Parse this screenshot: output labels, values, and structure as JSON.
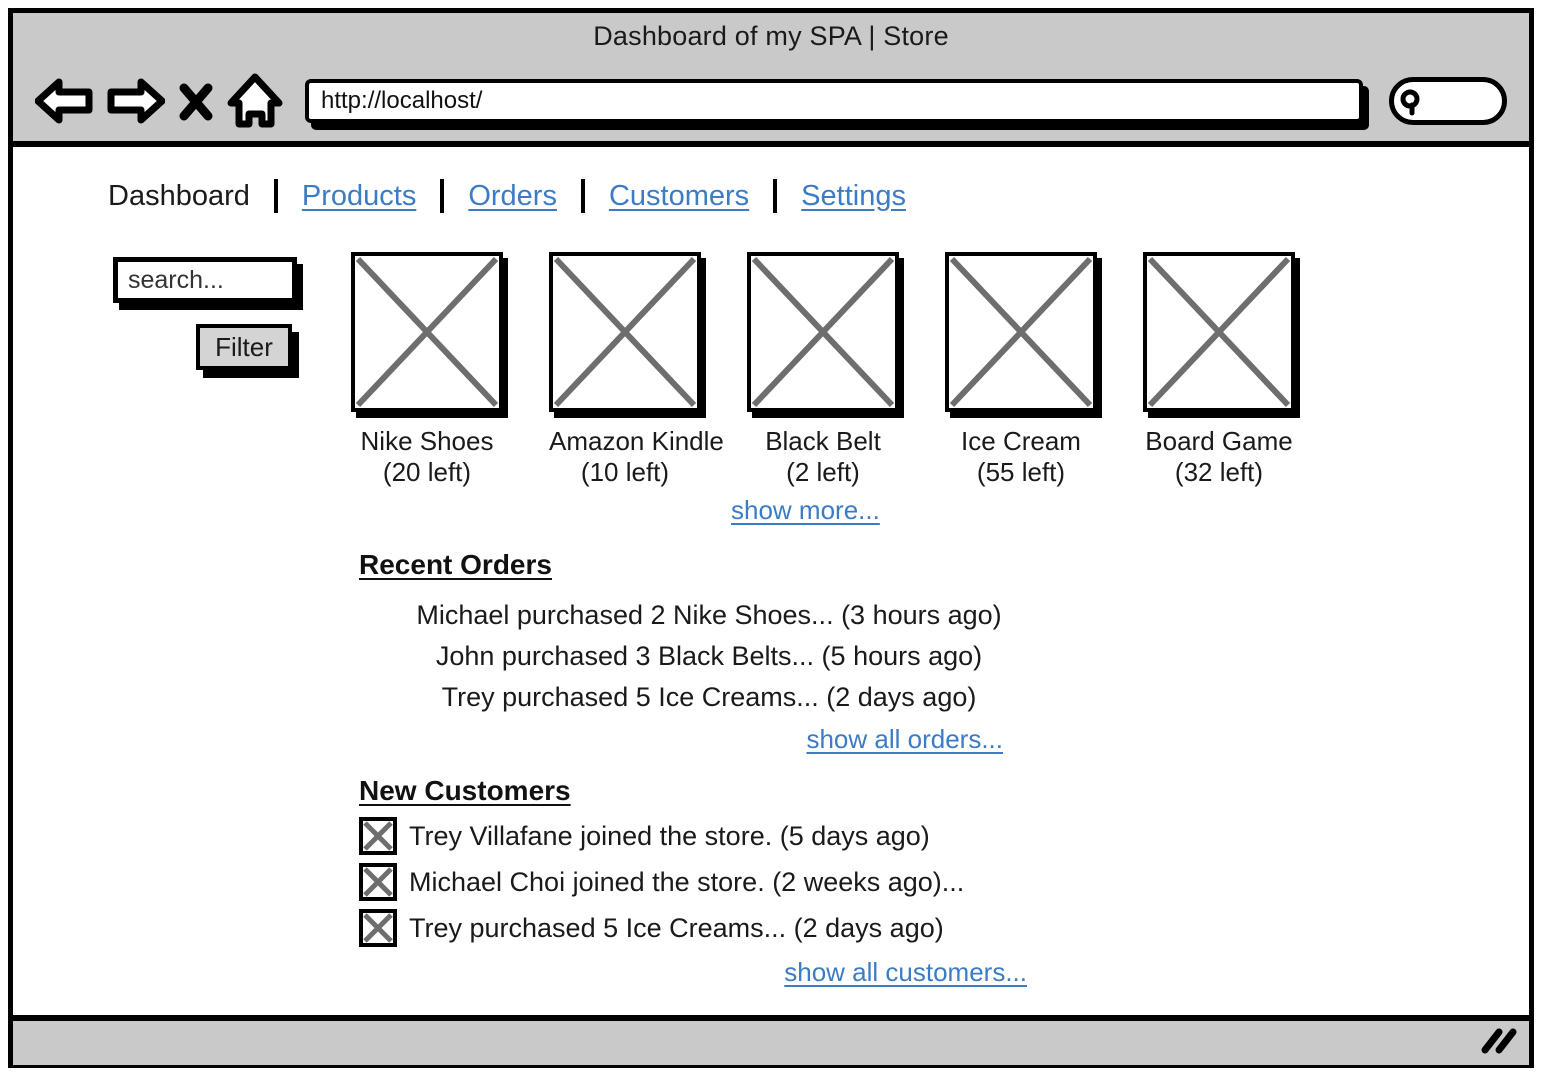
{
  "browser": {
    "window_title": "Dashboard of my SPA | Store",
    "url": "http://localhost/",
    "back_icon": "back-arrow-icon",
    "forward_icon": "forward-arrow-icon",
    "stop_icon": "close-x-icon",
    "home_icon": "home-icon",
    "browser_search_icon": "magnifier-icon",
    "browser_search_value": "",
    "resize_grip_icon": "resize-grip-icon"
  },
  "nav": {
    "active": "Dashboard",
    "links": [
      {
        "label": "Products"
      },
      {
        "label": "Orders"
      },
      {
        "label": "Customers"
      },
      {
        "label": "Settings"
      }
    ]
  },
  "filters": {
    "search_placeholder": "search...",
    "search_value": "",
    "filter_button": "Filter"
  },
  "products": {
    "items": [
      {
        "name": "Nike Shoes",
        "count": "(20 left)",
        "thumb_icon": "image-placeholder-icon"
      },
      {
        "name": "Amazon Kindle",
        "count": "(10 left)",
        "thumb_icon": "image-placeholder-icon"
      },
      {
        "name": "Black Belt",
        "count": "(2 left)",
        "thumb_icon": "image-placeholder-icon"
      },
      {
        "name": "Ice Cream",
        "count": "(55 left)",
        "thumb_icon": "image-placeholder-icon"
      },
      {
        "name": "Board Game",
        "count": "(32 left)",
        "thumb_icon": "image-placeholder-icon"
      }
    ],
    "show_more_label": "show more..."
  },
  "recent_orders": {
    "heading": "Recent Orders",
    "rows": [
      {
        "text": "Michael purchased 2 Nike Shoes... (3 hours ago)"
      },
      {
        "text": "John purchased 3 Black Belts... (5 hours ago)"
      },
      {
        "text": "Trey purchased 5 Ice Creams... (2 days ago)"
      }
    ],
    "show_all_label": "show all orders..."
  },
  "new_customers": {
    "heading": "New Customers",
    "rows": [
      {
        "avatar_icon": "avatar-placeholder-icon",
        "text": "Trey Villafane joined the store. (5 days ago)"
      },
      {
        "avatar_icon": "avatar-placeholder-icon",
        "text": "Michael Choi joined the store. (2 weeks ago)..."
      },
      {
        "avatar_icon": "avatar-placeholder-icon",
        "text": "Trey purchased 5 Ice Creams... (2 days ago)"
      }
    ],
    "show_all_label": "show all customers..."
  },
  "colors": {
    "link": "#3b7cc4",
    "chrome_gray": "#c9c9c9",
    "button_gray": "#d4d4d4",
    "outline": "#000000",
    "placeholder_x": "#6e6e6e"
  }
}
